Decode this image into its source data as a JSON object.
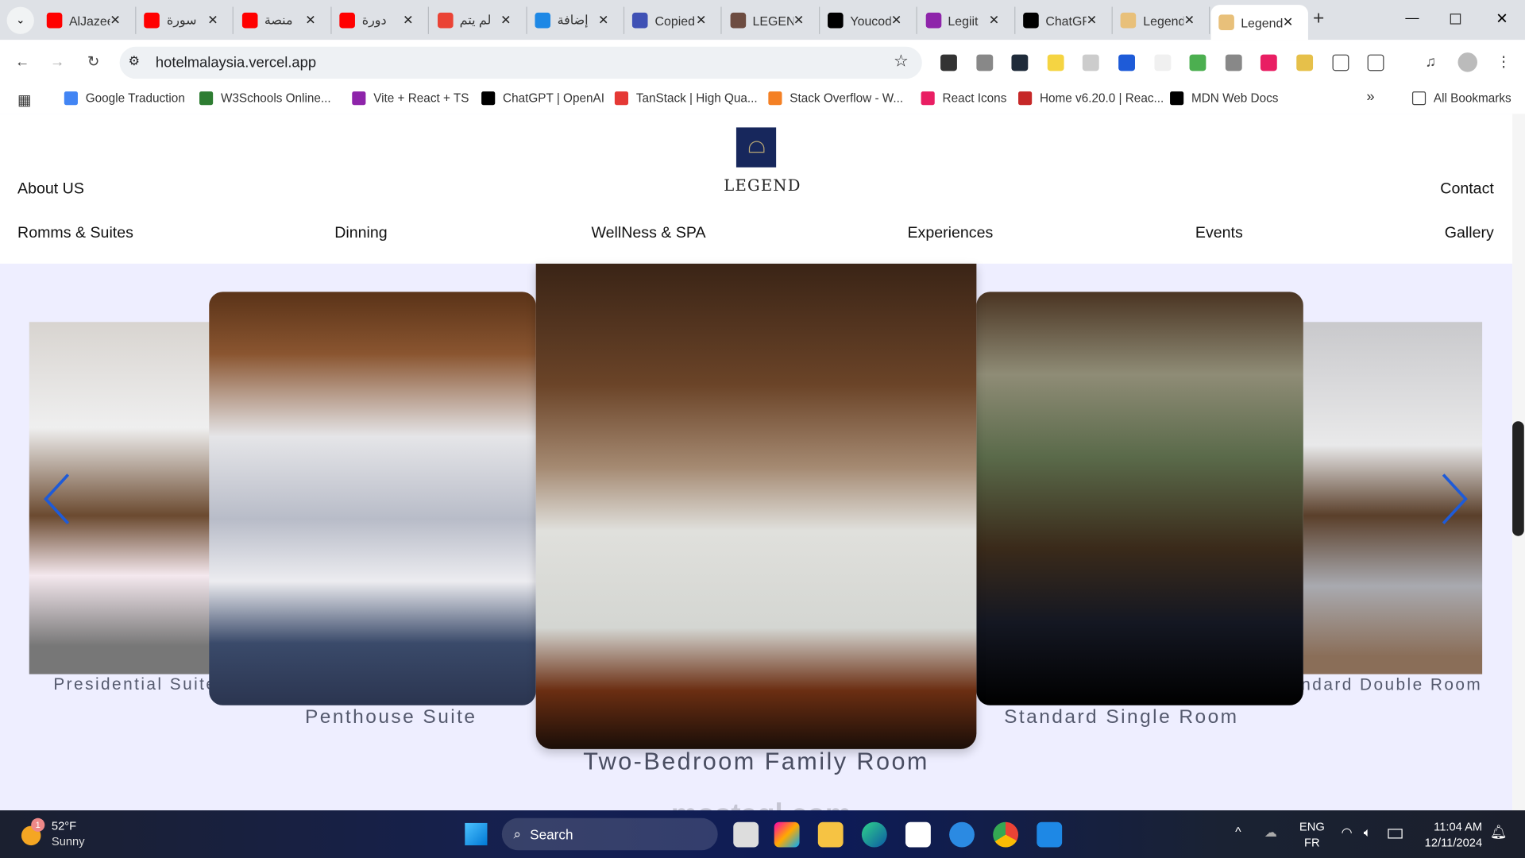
{
  "browser": {
    "tabs": [
      {
        "title": "AlJazeera",
        "color": "#ff0000"
      },
      {
        "title": "سورة",
        "color": "#ff0000"
      },
      {
        "title": "منصة",
        "color": "#ff0000"
      },
      {
        "title": "دورة",
        "color": "#ff0000"
      },
      {
        "title": "لم يتم",
        "color": "#ea4335"
      },
      {
        "title": "إضافة",
        "color": "#1e88e5"
      },
      {
        "title": "Copied",
        "color": "#3f51b5"
      },
      {
        "title": "LEGEND",
        "color": "#6d4c41"
      },
      {
        "title": "Youcode",
        "color": "#000000"
      },
      {
        "title": "Legiit",
        "color": "#8e24aa"
      },
      {
        "title": "ChatGPT",
        "color": "#000000"
      },
      {
        "title": "Legend",
        "color": "#e8c07a"
      },
      {
        "title": "Legend",
        "color": "#e8c07a",
        "active": true
      }
    ],
    "close_glyph": "✕",
    "new_tab": "+",
    "url": "hotelmalaysia.vercel.app",
    "bookmarks": [
      "Google Traduction",
      "W3Schools Online...",
      "Vite + React + TS",
      "ChatGPT | OpenAI",
      "TanStack | High Qua...",
      "Stack Overflow - W...",
      "React Icons",
      "Home v6.20.0 | Reac...",
      "MDN Web Docs"
    ],
    "more_bookmarks": "»",
    "all_bookmarks": "All Bookmarks"
  },
  "site": {
    "brand": "LEGEND",
    "top_nav": {
      "left": "About US",
      "right": "Contact"
    },
    "nav": [
      "Romms & Suites",
      "Dinning",
      "WellNess & SPA",
      "Experiences",
      "Events",
      "Gallery"
    ],
    "carousel": [
      {
        "label": "Presidential Suite"
      },
      {
        "label": "Penthouse Suite"
      },
      {
        "label": "Two-Bedroom Family Room",
        "active": true
      },
      {
        "label": "Standard Single Room"
      },
      {
        "label": "Standard Double Room"
      }
    ],
    "accent": "#1e5bd8",
    "background": "#eeeeff"
  },
  "taskbar": {
    "weather": {
      "temp": "52°F",
      "cond": "Sunny",
      "badge": "1"
    },
    "search": "Search",
    "lang": {
      "a": "ENG",
      "b": "FR"
    },
    "time": "11:04 AM",
    "date": "12/11/2024"
  },
  "watermark": "mostaql.com"
}
